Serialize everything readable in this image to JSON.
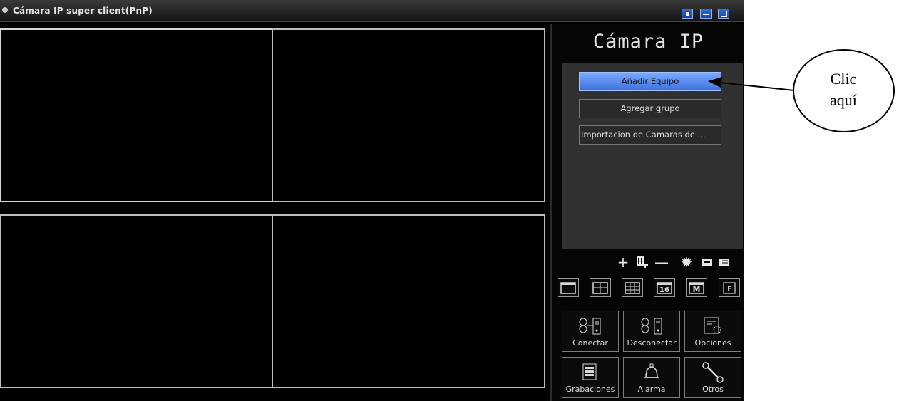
{
  "window": {
    "title": "Cámara IP super client(PnP)",
    "controls": [
      "options-icon",
      "minimize-icon",
      "maximize-icon"
    ]
  },
  "video_grid": {
    "cells": [
      {
        "name": "video-cell-1"
      },
      {
        "name": "video-cell-2"
      },
      {
        "name": "video-cell-3"
      },
      {
        "name": "video-cell-4"
      }
    ]
  },
  "panel": {
    "brand": "Cámara IP",
    "device_buttons": {
      "add_device_prefix": "A",
      "add_device_underlined": "ñ",
      "add_device_rest": "adir Equipo",
      "add_group_prefix": "Agregar ",
      "add_group_underlined": "g",
      "add_group_rest": "rupo",
      "import_cameras": "Importacion de Camaras de ..."
    },
    "toolbar_icons": [
      "plus-icon",
      "device-add-icon",
      "minus-icon",
      "gear-icon",
      "export-icon",
      "list-icon"
    ],
    "layout_buttons": {
      "sixteen": "16",
      "m": "M",
      "f": "F"
    },
    "actions": {
      "connect": "Conectar",
      "disconnect": "Desconectar",
      "options": "Opciones",
      "recordings": "Grabaciones",
      "alarm": "Alarma",
      "others": "Otros"
    }
  },
  "annotation": {
    "line1": "Clic",
    "line2": "aquí"
  },
  "colors": {
    "accent": "#5a8cf0",
    "background": "#000000",
    "panel_area": "#313131"
  }
}
